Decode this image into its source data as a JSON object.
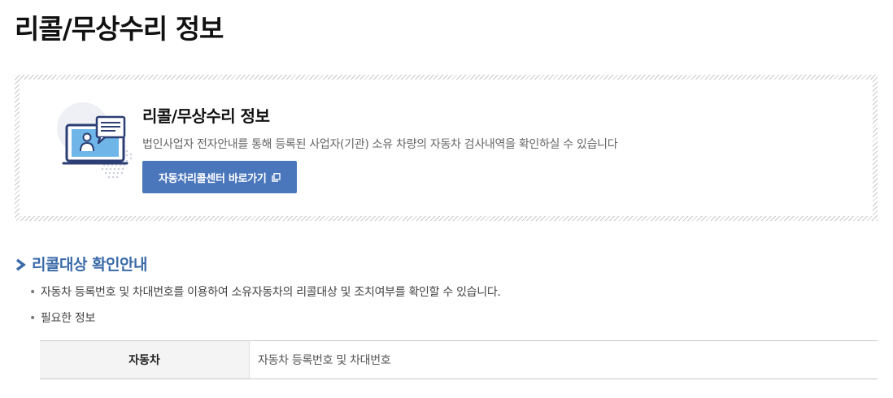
{
  "page": {
    "title": "리콜/무상수리 정보"
  },
  "info_box": {
    "icon": "monitor-with-person-icon",
    "title": "리콜/무상수리 정보",
    "description": "법인사업자 전자안내를 통해 등록된 사업자(기관) 소유 차량의 자동차 검사내역을 확인하실 수 있습니다",
    "button_label": "자동차리콜센터 바로가기",
    "button_icon": "external-window-icon",
    "accent_color": "#4a76bb"
  },
  "section": {
    "icon": "chevron-right-icon",
    "title": "리콜대상 확인안내",
    "title_color": "#3a6aa8",
    "bullets": [
      "자동차 등록번호 및 차대번호를 이용하여 소유자동차의 리콜대상 및 조치여부를 확인할 수 있습니다.",
      "필요한 정보"
    ],
    "table": {
      "rows": [
        {
          "header": "자동차",
          "value": "자동차 등록번호 및 차대번호"
        }
      ]
    }
  }
}
